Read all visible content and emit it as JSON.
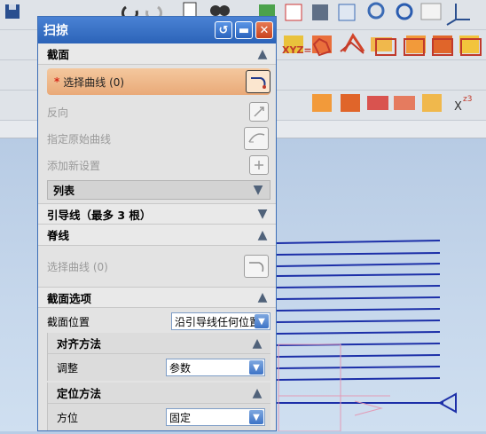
{
  "dialog": {
    "title": "扫掠",
    "buttons": {
      "reset": "↺",
      "minimize": "▬",
      "close": "✕"
    }
  },
  "section_cross": {
    "label": "截面",
    "select_curve": {
      "star": "*",
      "label": "选择曲线 (0)"
    },
    "reverse": "反向",
    "start_curve": "指定原始曲线",
    "add_set": "添加新设置",
    "list": "列表"
  },
  "section_guide": {
    "label": "引导线（最多 3 根）"
  },
  "section_spine": {
    "label": "脊线",
    "select_curve": "选择曲线 (0)"
  },
  "section_options": {
    "label": "截面选项",
    "position": {
      "label": "截面位置",
      "value": "沿引导线任何位置"
    },
    "alignment": {
      "label": "对齐方法",
      "adjust": {
        "label": "调整",
        "value": "参数"
      }
    },
    "orientation": {
      "label": "定位方法",
      "direction": {
        "label": "方位",
        "value": "固定"
      }
    }
  },
  "icons": [
    "save-icon",
    "cut-icon",
    "copy-icon",
    "paste-icon",
    "undo-icon",
    "redo-icon",
    "info-icon",
    "binocular-icon",
    "refresh-icon",
    "fit-icon",
    "shade-icon",
    "zoom-icon",
    "rotate-icon",
    "orient-icon",
    "axis-icon"
  ],
  "colors": {
    "title_bar": "#2c63b8",
    "highlight": "#e9a978",
    "curves": "#1c2fa8",
    "required": "#d62a1a"
  }
}
